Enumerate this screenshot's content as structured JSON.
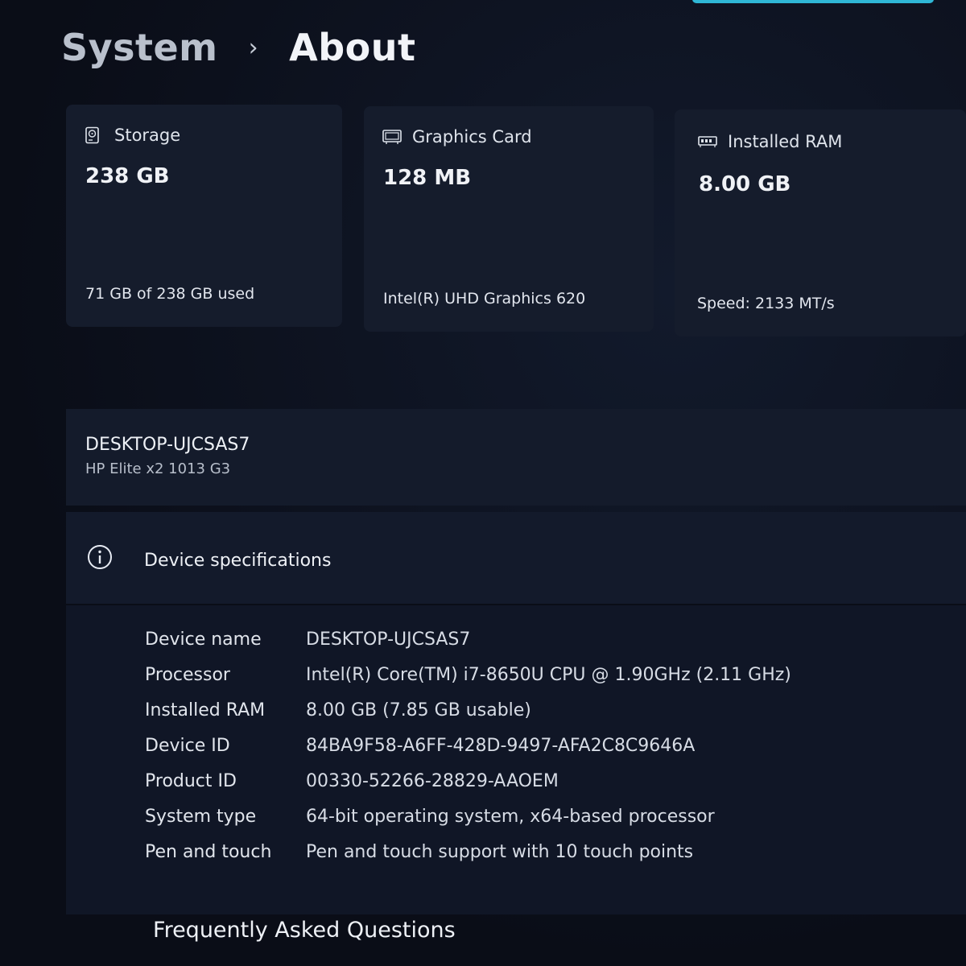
{
  "breadcrumb": {
    "parent": "System",
    "separator": "›",
    "current": "About"
  },
  "cards": {
    "storage": {
      "icon": "storage-drive-icon",
      "title": "Storage",
      "value": "238 GB",
      "detail": "71 GB of 238 GB used"
    },
    "graphics": {
      "icon": "graphics-card-icon",
      "title": "Graphics Card",
      "value": "128 MB",
      "detail": "Intel(R) UHD Graphics 620"
    },
    "ram": {
      "icon": "memory-module-icon",
      "title": "Installed RAM",
      "value": "8.00 GB",
      "detail": "Speed: 2133 MT/s"
    }
  },
  "device": {
    "name": "DESKTOP-UJCSAS7",
    "model": "HP Elite x2 1013 G3"
  },
  "specs": {
    "icon": "info-icon",
    "title": "Device specifications",
    "rows": [
      {
        "label": "Device name",
        "value": "DESKTOP-UJCSAS7"
      },
      {
        "label": "Processor",
        "value": "Intel(R) Core(TM) i7-8650U CPU @ 1.90GHz (2.11 GHz)"
      },
      {
        "label": "Installed RAM",
        "value": "8.00 GB (7.85 GB usable)"
      },
      {
        "label": "Device ID",
        "value": "84BA9F58-A6FF-428D-9497-AFA2C8C9646A"
      },
      {
        "label": "Product ID",
        "value": "00330-52266-28829-AAOEM"
      },
      {
        "label": "System type",
        "value": "64-bit operating system, x64-based processor"
      },
      {
        "label": "Pen and touch",
        "value": "Pen and touch support with 10 touch points"
      }
    ]
  },
  "faq": {
    "title": "Frequently Asked Questions"
  },
  "colors": {
    "accent": "#2fb7d6",
    "background": "#0b0e18",
    "card": "#151c2c"
  }
}
